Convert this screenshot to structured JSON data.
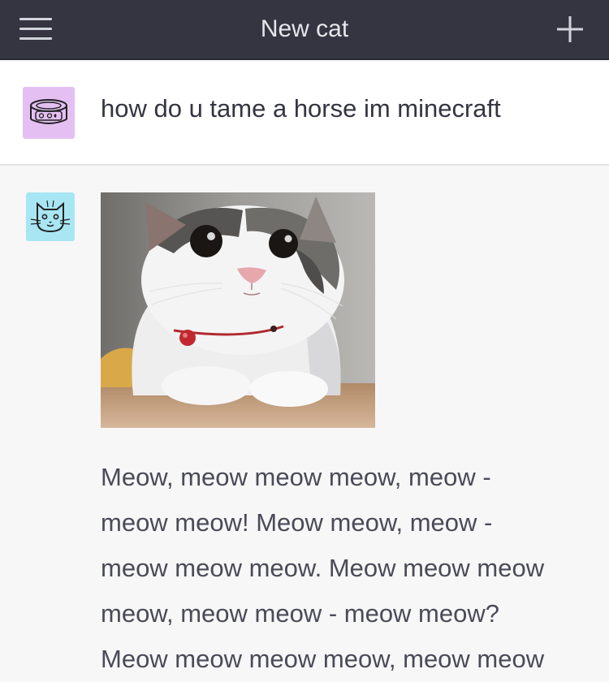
{
  "header": {
    "title": "New cat",
    "menu_icon": "hamburger-menu-icon",
    "new_icon": "plus-icon",
    "background": "#343541"
  },
  "conversation": {
    "user_message": {
      "text": "how do u tame a horse im minecraft",
      "avatar_icon": "cat-food-can-icon",
      "avatar_color": "#e3bff2"
    },
    "assistant_message": {
      "avatar_icon": "cat-face-icon",
      "avatar_color": "#a9e6f3",
      "image": "cat-photo",
      "lines": [
        "Meow, meow meow meow, meow -",
        "meow meow! Meow meow, meow -",
        "meow meow meow. Meow meow meow",
        "meow, meow meow - meow meow?",
        "Meow meow meow meow, meow meow"
      ]
    }
  }
}
